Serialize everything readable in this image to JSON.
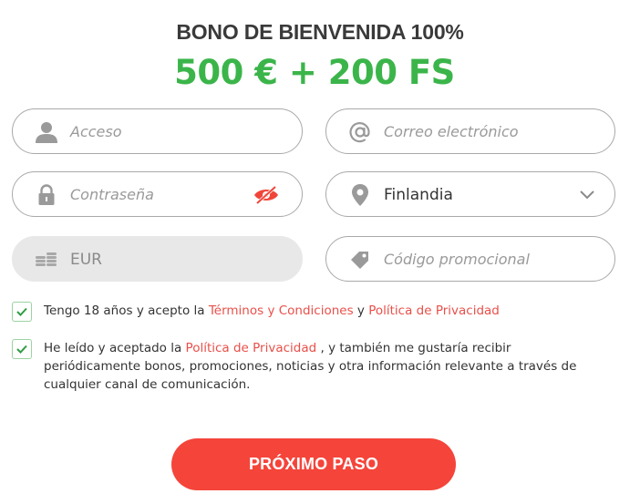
{
  "header": {
    "title": "BONO DE BIENVENIDA 100%",
    "amount": "500 € + 200 FS"
  },
  "form": {
    "login_placeholder": "Acceso",
    "email_placeholder": "Correo electrónico",
    "password_placeholder": "Contraseña",
    "country_value": "Finlandia",
    "currency_value": "EUR",
    "promo_placeholder": "Código promocional"
  },
  "consent": {
    "age": {
      "prefix": "Tengo 18 años y acepto la ",
      "terms_link": "Términos y Condiciones",
      "mid": " y ",
      "privacy_link": "Política de Privacidad"
    },
    "marketing": {
      "prefix": "He leído y aceptado la ",
      "privacy_link": "Política de Privacidad",
      "suffix": " , y también me gustaría recibir periódicamente bonos, promociones, noticias y otra información relevante a través de cualquier canal de comunicación."
    }
  },
  "actions": {
    "next_label": "PRÓXIMO PASO"
  },
  "colors": {
    "accent_green": "#3bb54a",
    "button_red": "#f5443a",
    "link_red": "#e8504a",
    "icon_gray": "#9a9a9a"
  },
  "icons": {
    "login": "user-icon",
    "email": "at-icon",
    "password": "lock-icon",
    "toggle_password": "eye-slash-icon",
    "country": "location-pin-icon",
    "dropdown": "chevron-down-icon",
    "currency": "coins-icon",
    "promo": "tag-icon",
    "checkbox": "checkmark-icon"
  }
}
